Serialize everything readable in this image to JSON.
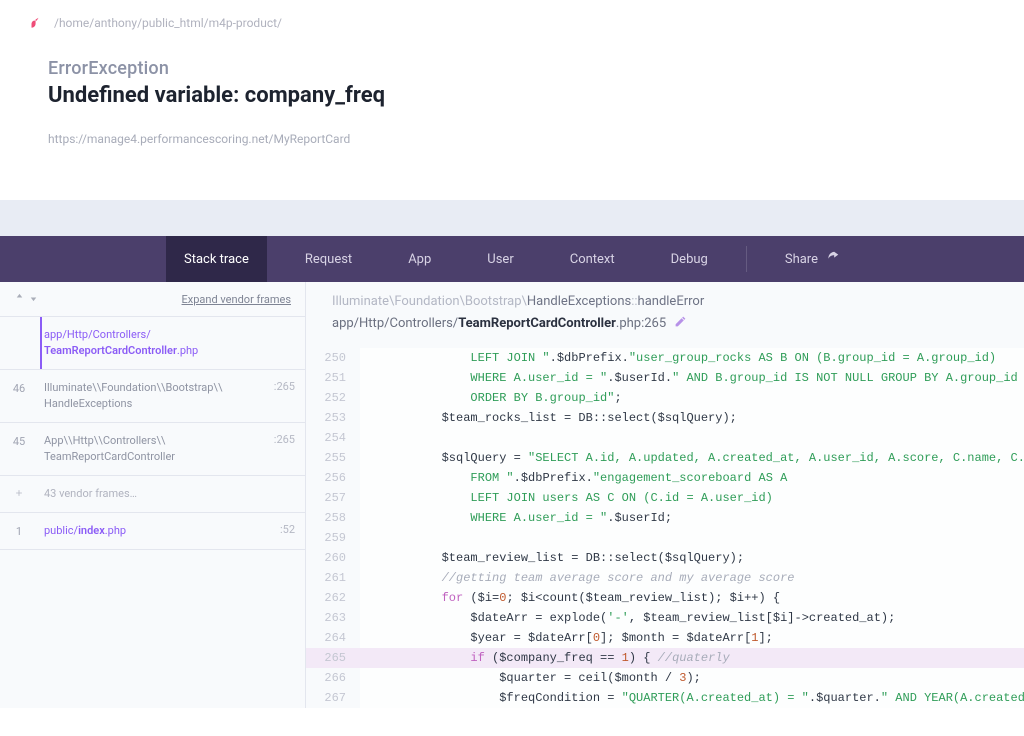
{
  "breadcrumb": "/home/anthony/public_html/m4p-product/",
  "exception": {
    "class": "ErrorException",
    "message": "Undefined variable: company_freq",
    "url": "https://manage4.performancescoring.net/MyReportCard"
  },
  "tabs": {
    "stack": "Stack trace",
    "request": "Request",
    "app": "App",
    "user": "User",
    "context": "Context",
    "debug": "Debug",
    "share": "Share"
  },
  "stack": {
    "expand": "Expand vendor frames",
    "frames": [
      {
        "num": "",
        "body_html": "app/Http/Controllers/<br><strong>TeamReportCardController</strong>.php",
        "ln": "",
        "active": true,
        "clickable": true
      },
      {
        "num": "46",
        "body_html": "Illuminate\\\\Foundation\\\\Bootstrap\\\\<br>HandleExceptions",
        "ln": ":265"
      },
      {
        "num": "45",
        "body_html": "App\\\\Http\\\\Controllers\\\\<br>TeamReportCardController",
        "ln": ":265"
      },
      {
        "num": "+",
        "body_html": "43 vendor frames…",
        "ln": "",
        "vendor": true
      },
      {
        "num": "1",
        "body_html": "public/<strong>index</strong>.php",
        "ln": ":52",
        "clickable": true
      }
    ]
  },
  "context": {
    "ns": "Illuminate\\Foundation\\Bootstrap\\",
    "cls": "HandleExceptions",
    "mth": "handleError",
    "path_prefix": "app/Http/Controllers/",
    "path_bold": "TeamReportCardController",
    "path_suffix": ".php:265"
  },
  "code": [
    {
      "n": 250,
      "t": "            <span class='tok-str'>LEFT JOIN \"</span>.$dbPrefix.<span class='tok-str'>\"user_group_rocks AS B ON (B.group_id = A.group_id)</span>"
    },
    {
      "n": 251,
      "t": "            <span class='tok-str'>WHERE A.user_id = \"</span>.$userId.<span class='tok-str'>\" AND B.group_id IS NOT NULL GROUP BY A.group_id</span>"
    },
    {
      "n": 252,
      "t": "            <span class='tok-str'>ORDER BY B.group_id\"</span>;"
    },
    {
      "n": 253,
      "t": "        $team_rocks_list = DB::select($sqlQuery);"
    },
    {
      "n": 254,
      "t": ""
    },
    {
      "n": 255,
      "t": "        $sqlQuery = <span class='tok-str'>\"SELECT A.id, A.updated, A.created_at, A.user_id, A.score, C.name, C.last_name</span>"
    },
    {
      "n": 256,
      "t": "            <span class='tok-str'>FROM \"</span>.$dbPrefix.<span class='tok-str'>\"engagement_scoreboard AS A</span>"
    },
    {
      "n": 257,
      "t": "            <span class='tok-str'>LEFT JOIN users AS C ON (C.id = A.user_id)</span>"
    },
    {
      "n": 258,
      "t": "            <span class='tok-str'>WHERE A.user_id = \"</span>.$userId;"
    },
    {
      "n": 259,
      "t": ""
    },
    {
      "n": 260,
      "t": "        $team_review_list = DB::select($sqlQuery);"
    },
    {
      "n": 261,
      "t": "        <span class='tok-cmt'>//getting team average score and my average score</span>"
    },
    {
      "n": 262,
      "t": "        <span class='tok-kw'>for</span> ($i=<span class='tok-num'>0</span>; $i&lt;count($team_review_list); $i++) {"
    },
    {
      "n": 263,
      "t": "            $dateArr = explode(<span class='tok-str'>'-'</span>, $team_review_list[$i]-&gt;created_at);"
    },
    {
      "n": 264,
      "t": "            $year = $dateArr[<span class='tok-num'>0</span>]; $month = $dateArr[<span class='tok-num'>1</span>];"
    },
    {
      "n": 265,
      "t": "            <span class='tok-kw'>if</span> ($company_freq == <span class='tok-num'>1</span>) { <span class='tok-cmt'>//quaterly</span>",
      "hl": true
    },
    {
      "n": 266,
      "t": "                $quarter = ceil($month / <span class='tok-num'>3</span>);"
    },
    {
      "n": 267,
      "t": "                $freqCondition = <span class='tok-str'>\"QUARTER(A.created_at) = \"</span>.$quarter.<span class='tok-str'>\" AND YEAR(A.created_at) = \"</span>.$year;"
    }
  ]
}
